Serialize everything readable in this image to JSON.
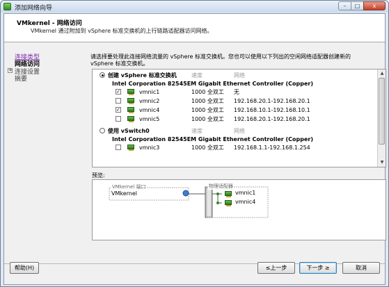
{
  "window": {
    "title": "添加网络向导",
    "buttons": [
      "–",
      "□",
      "x"
    ]
  },
  "header": {
    "title": "VMkernel - 网络访问",
    "subtitle": "VMkernel 通过附加到 vSphere 标准交换机的上行链路适配器访问网络。"
  },
  "nav": {
    "items": [
      {
        "label": "连接类型"
      },
      {
        "label": "网络访问"
      },
      {
        "label": "连接设置"
      },
      {
        "label": "摘要"
      }
    ],
    "expander": "+"
  },
  "instructions": "请选择要处理此连接网络流量的 vSphere 标准交换机。您也可以使用以下列出的空闲网络适配器创建新的 vSphere 标准交换机。",
  "list": {
    "col_speed": "速度",
    "col_network": "网络",
    "groups": [
      {
        "label": "创建 vSphere 标准交换机",
        "selected": true,
        "adapter": "Intel Corporation 82545EM Gigabit Ethernet Controller (Copper)",
        "nics": [
          {
            "name": "vmnic1",
            "checked": true,
            "speed": "1000 全双工",
            "network": "无"
          },
          {
            "name": "vmnic2",
            "checked": false,
            "speed": "1000 全双工",
            "network": "192.168.20.1-192.168.20.1"
          },
          {
            "name": "vmnic4",
            "checked": true,
            "speed": "1000 全双工",
            "network": "192.168.10.1-192.168.10.1"
          },
          {
            "name": "vmnic5",
            "checked": false,
            "speed": "1000 全双工",
            "network": "192.168.20.1-192.168.20.1"
          }
        ]
      },
      {
        "label": "使用 vSwitch0",
        "selected": false,
        "adapter": "Intel Corporation 82545EM Gigabit Ethernet Controller (Copper)",
        "nics": [
          {
            "name": "vmnic3",
            "checked": false,
            "speed": "1000 全双工",
            "network": "192.168.1.1-192.168.1.254"
          }
        ]
      }
    ]
  },
  "preview": {
    "label": "预览:",
    "port_group_label": "VMkernel 端口",
    "port_name": "VMkernel",
    "adapters_label": "物理适配器",
    "adapters": [
      "vmnic1",
      "vmnic4"
    ]
  },
  "footer": {
    "help": "帮助(H)",
    "back": "≤上一步",
    "next": "下一步 ≥",
    "cancel": "取消"
  },
  "colors": {
    "nic_green": "#3a9a2a",
    "visited_link": "#7b2fa8",
    "default_button_border": "#3c7fb1"
  }
}
